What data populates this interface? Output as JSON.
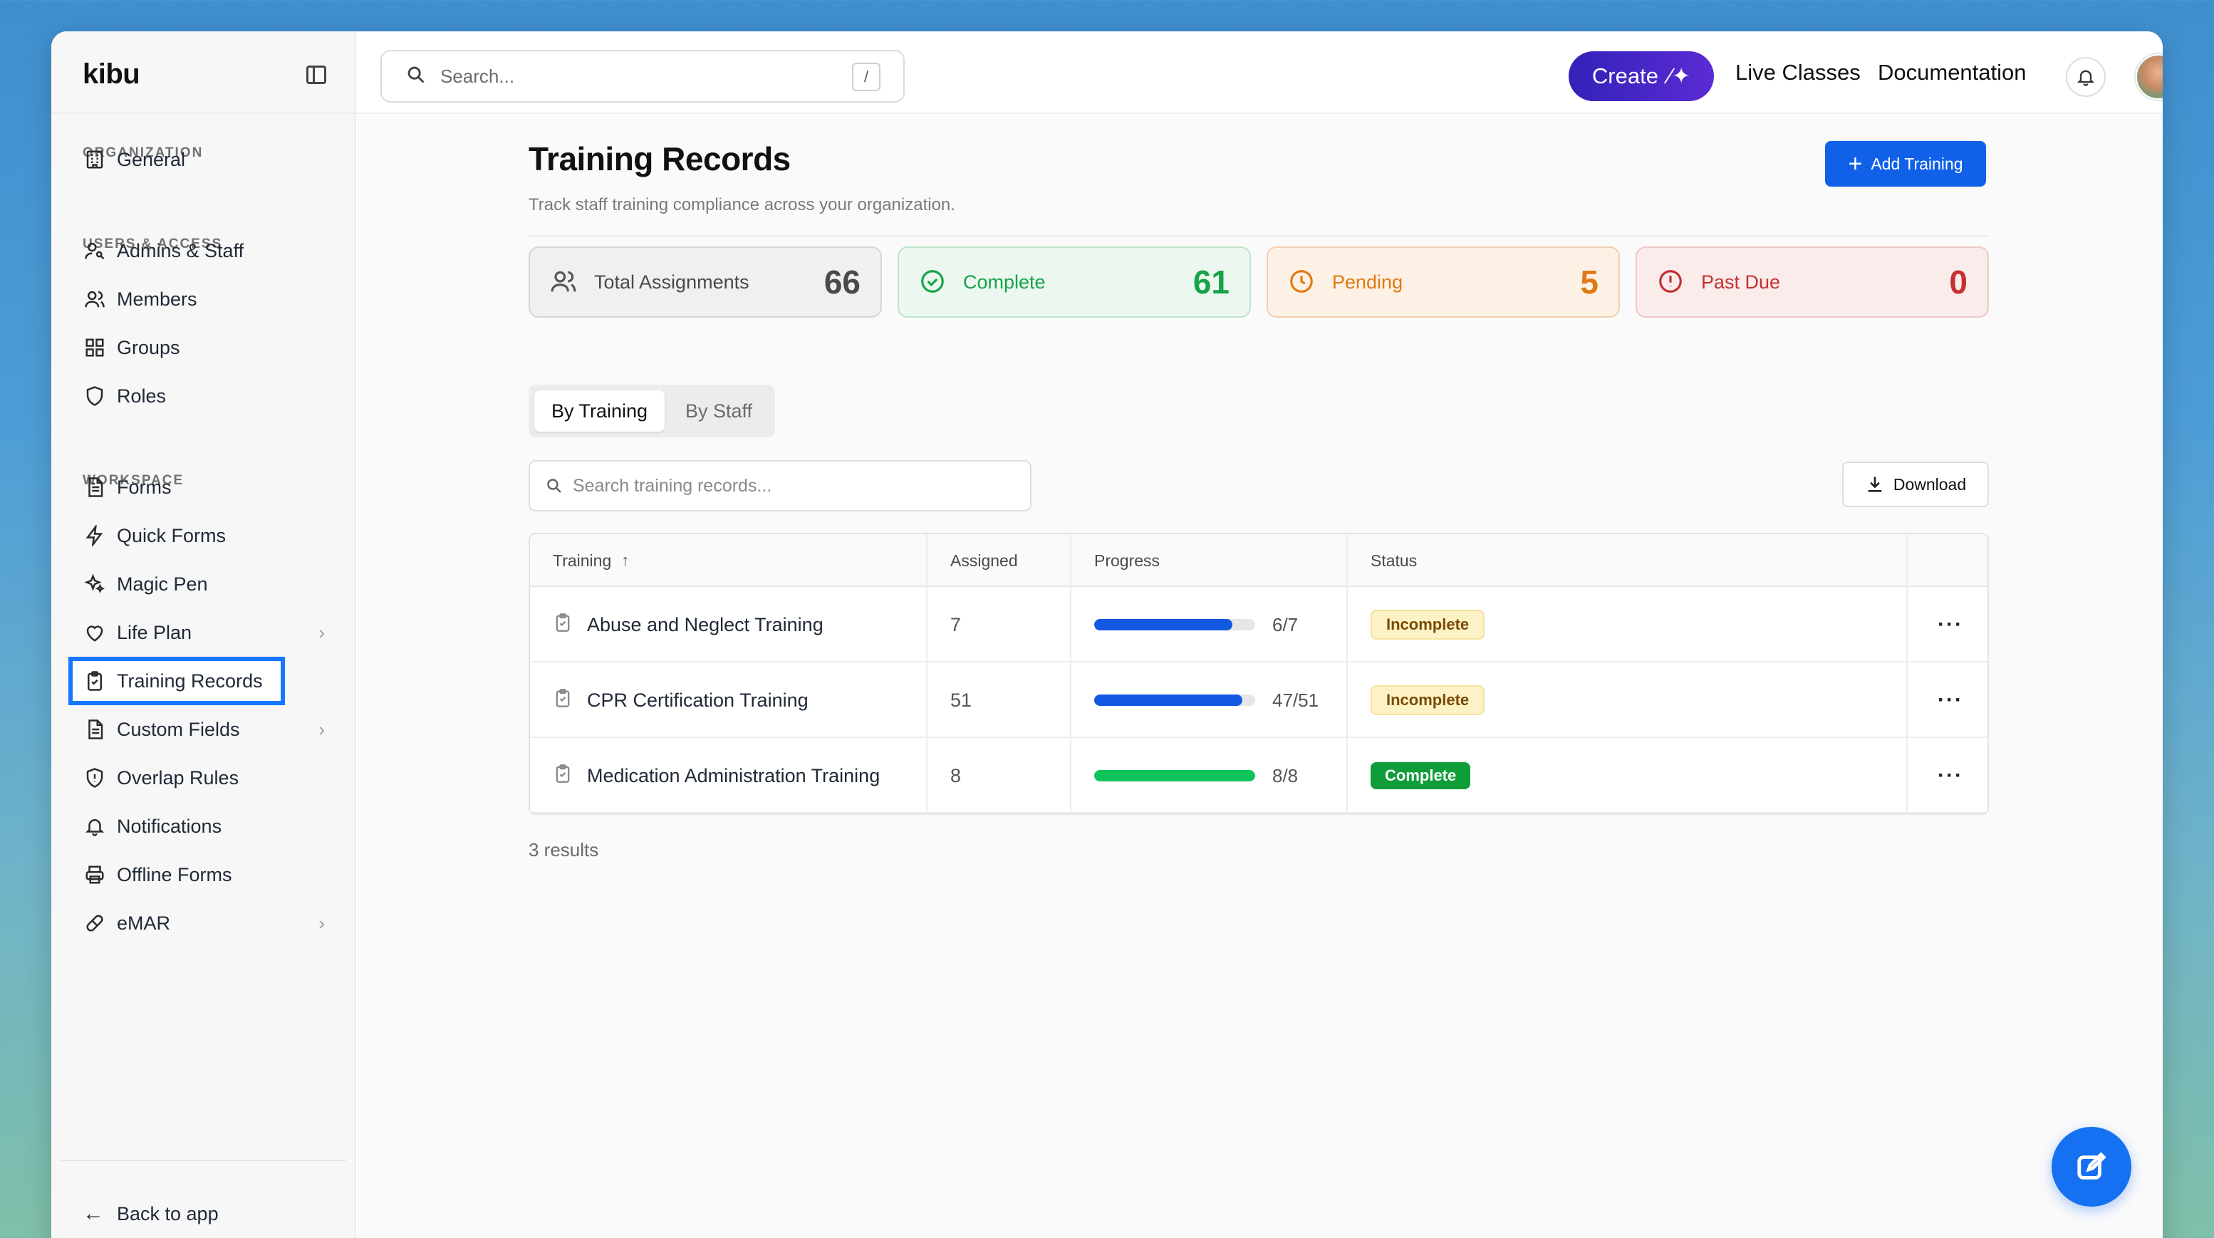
{
  "app": {
    "brand": "kibu"
  },
  "sidebar": {
    "sections": {
      "organization": "ORGANIZATION",
      "users_access": "USERS & ACCESS",
      "workspace": "WORKSPACE"
    },
    "items": [
      {
        "label": "General",
        "icon": "building-icon"
      },
      {
        "label": "Admins & Staff",
        "icon": "user-key-icon"
      },
      {
        "label": "Members",
        "icon": "users-icon"
      },
      {
        "label": "Groups",
        "icon": "grid-icon"
      },
      {
        "label": "Roles",
        "icon": "shield-icon"
      },
      {
        "label": "Forms",
        "icon": "document-icon"
      },
      {
        "label": "Quick Forms",
        "icon": "lightning-icon"
      },
      {
        "label": "Magic Pen",
        "icon": "sparkles-icon"
      },
      {
        "label": "Life Plan",
        "icon": "heart-icon",
        "has_children": true
      },
      {
        "label": "Training Records",
        "icon": "clipboard-check-icon",
        "active": true
      },
      {
        "label": "Custom Fields",
        "icon": "document-icon",
        "has_children": true
      },
      {
        "label": "Overlap Rules",
        "icon": "shield-alert-icon"
      },
      {
        "label": "Notifications",
        "icon": "bell-icon"
      },
      {
        "label": "Offline Forms",
        "icon": "printer-icon"
      },
      {
        "label": "eMAR",
        "icon": "pill-icon",
        "has_children": true
      }
    ],
    "back_label": "Back to app"
  },
  "topbar": {
    "search_placeholder": "Search...",
    "search_shortcut": "/",
    "create_label": "Create",
    "links": [
      "Live Classes",
      "Documentation"
    ]
  },
  "page": {
    "title": "Training Records",
    "subtitle": "Track staff training compliance across your organization.",
    "add_button": "Add Training",
    "stats": [
      {
        "label": "Total Assignments",
        "value": "66",
        "color": "#4a4a4a",
        "bg": "#f0f0f0",
        "border": "#d6d6d6"
      },
      {
        "label": "Complete",
        "value": "61",
        "color": "#16a34a",
        "bg": "#ecf8ef",
        "border": "#bfe5c9"
      },
      {
        "label": "Pending",
        "value": "5",
        "color": "#e07a12",
        "bg": "#fdf1e6",
        "border": "#f3cfae"
      },
      {
        "label": "Past Due",
        "value": "0",
        "color": "#c53030",
        "bg": "#fbecec",
        "border": "#efc7c7"
      }
    ],
    "view_toggle": {
      "active": "By Training",
      "inactive": "By Staff"
    },
    "table_search_placeholder": "Search training records...",
    "download_label": "Download",
    "table": {
      "columns": [
        "Training",
        "Assigned",
        "Progress",
        "Status"
      ],
      "rows": [
        {
          "training": "Abuse and Neglect Training",
          "assigned": "7",
          "progress_ratio": "6/7",
          "progress": 0.857,
          "status": "Incomplete",
          "bar_color": "#1358e0"
        },
        {
          "training": "CPR Certification Training",
          "assigned": "51",
          "progress_ratio": "47/51",
          "progress": 0.922,
          "status": "Incomplete",
          "bar_color": "#1358e0"
        },
        {
          "training": "Medication Administration Training",
          "assigned": "8",
          "progress_ratio": "8/8",
          "progress": 1.0,
          "status": "Complete",
          "bar_color": "#10c45c"
        }
      ]
    },
    "results_text": "3 results"
  }
}
